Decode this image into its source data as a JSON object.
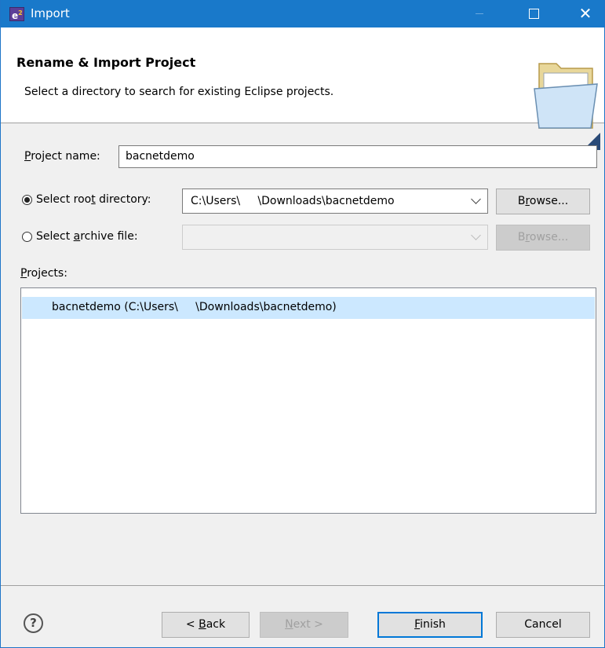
{
  "window": {
    "title": "Import",
    "app_icon_letter": "e",
    "app_icon_super": "2"
  },
  "banner": {
    "title": "Rename & Import Project",
    "message": "Select a directory to search for existing Eclipse projects."
  },
  "project_name": {
    "label_u": "P",
    "label_rest": "roject name:",
    "value": "bacnetdemo"
  },
  "root_dir": {
    "label_pre": "Select roo",
    "label_u": "t",
    "label_post": " directory:",
    "checked": true,
    "value": "C:\\Users\\     \\Downloads\\bacnetdemo",
    "browse_u": "r",
    "browse_pre": "B",
    "browse_post": "owse..."
  },
  "archive": {
    "label_pre": "Select ",
    "label_u": "a",
    "label_post": "rchive file:",
    "checked": false,
    "value": "",
    "browse_pre": "B",
    "browse_u": "r",
    "browse_post": "owse..."
  },
  "projects": {
    "label_u": "P",
    "label_rest": "rojects:",
    "items": [
      "bacnetdemo (C:\\Users\\     \\Downloads\\bacnetdemo)"
    ]
  },
  "footer": {
    "back_pre": "< ",
    "back_u": "B",
    "back_post": "ack",
    "next_u": "N",
    "next_post": "ext >",
    "finish_u": "F",
    "finish_post": "inish",
    "cancel": "Cancel",
    "help_glyph": "?"
  },
  "colors": {
    "titlebar": "#1979ca",
    "selection": "#cce8ff",
    "default_button_border": "#0078d7"
  }
}
